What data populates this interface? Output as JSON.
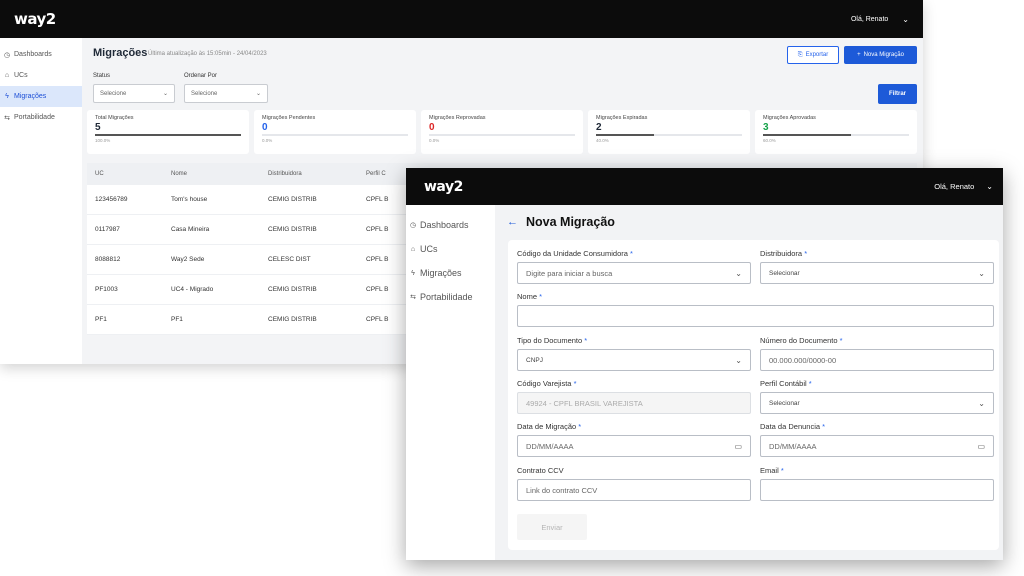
{
  "brand": {
    "logo": "way2"
  },
  "back": {
    "user_greeting": "Olá, Renato",
    "sidebar": [
      {
        "label": "Dashboards",
        "icon": "dashboard-icon",
        "glyph": "◷"
      },
      {
        "label": "UCs",
        "icon": "building-icon",
        "glyph": "⌂"
      },
      {
        "label": "Migrações",
        "icon": "lightning-icon",
        "glyph": "ϟ"
      },
      {
        "label": "Portabilidade",
        "icon": "portability-icon",
        "glyph": "⇆"
      }
    ],
    "title": "Migrações",
    "subtitle": "Última atualização às 15:05min - 24/04/2023",
    "export_label": "Exportar",
    "new_label": "Nova Migração",
    "status_label": "Status",
    "status_value": "Selecione",
    "order_label": "Ordenar Por",
    "order_value": "Selecione",
    "filter_label": "Filtrar",
    "stats": [
      {
        "label": "Total Migrações",
        "value": "5",
        "pct": "100.0%",
        "color": "#1f2937",
        "fill": 1.0
      },
      {
        "label": "Migrações Pendentes",
        "value": "0",
        "pct": "0.0%",
        "color": "#2563eb",
        "fill": 0
      },
      {
        "label": "Migrações Reprovadas",
        "value": "0",
        "pct": "0.0%",
        "color": "#dc2626",
        "fill": 0
      },
      {
        "label": "Migrações Expiradas",
        "value": "2",
        "pct": "40.0%",
        "color": "#1f2937",
        "fill": 0.4
      },
      {
        "label": "Migrações Aprovadas",
        "value": "3",
        "pct": "60.0%",
        "color": "#16a34a",
        "fill": 0.6
      }
    ],
    "table": {
      "headers": [
        "UC",
        "Nome",
        "Distribuidora",
        "Perfil C"
      ],
      "rows": [
        [
          "123456789",
          "Tom's house",
          "CEMIG DISTRIB",
          "CPFL B"
        ],
        [
          "0117987",
          "Casa Mineira",
          "CEMIG DISTRIB",
          "CPFL B"
        ],
        [
          "8088812",
          "Way2 Sede",
          "CELESC DIST",
          "CPFL B"
        ],
        [
          "PF1003",
          "UC4 - Migrado",
          "CEMIG DISTRIB",
          "CPFL B"
        ],
        [
          "PF1",
          "PF1",
          "CEMIG DISTRIB",
          "CPFL B"
        ]
      ]
    }
  },
  "front": {
    "user_greeting": "Olá, Renato",
    "sidebar": [
      {
        "label": "Dashboards",
        "icon": "dashboard-icon",
        "glyph": "◷"
      },
      {
        "label": "UCs",
        "icon": "building-icon",
        "glyph": "⌂"
      },
      {
        "label": "Migrações",
        "icon": "lightning-icon",
        "glyph": "ϟ"
      },
      {
        "label": "Portabilidade",
        "icon": "portability-icon",
        "glyph": "⇆"
      }
    ],
    "title": "Nova Migração",
    "form": {
      "uc_label": "Código da Unidade Consumidora",
      "uc_placeholder": "Digite para iniciar a busca",
      "dist_label": "Distribuidora",
      "dist_value": "Selecionar",
      "name_label": "Nome",
      "name_value": "",
      "doc_type_label": "Tipo do Documento",
      "doc_type_value": "CNPJ",
      "doc_num_label": "Número do Documento",
      "doc_num_placeholder": "00.000.000/0000-00",
      "retail_label": "Código Varejista",
      "retail_value": "49924 - CPFL BRASIL VAREJISTA",
      "profile_label": "Perfil Contábil",
      "profile_value": "Selecionar",
      "migration_date_label": "Data de Migração",
      "migration_date_placeholder": "DD/MM/AAAA",
      "complaint_date_label": "Data da Denuncia",
      "complaint_date_placeholder": "DD/MM/AAAA",
      "ccv_label": "Contrato CCV",
      "ccv_placeholder": "Link do contrato CCV",
      "email_label": "Email",
      "email_value": "",
      "required_mark": "*",
      "send_label": "Enviar"
    }
  }
}
